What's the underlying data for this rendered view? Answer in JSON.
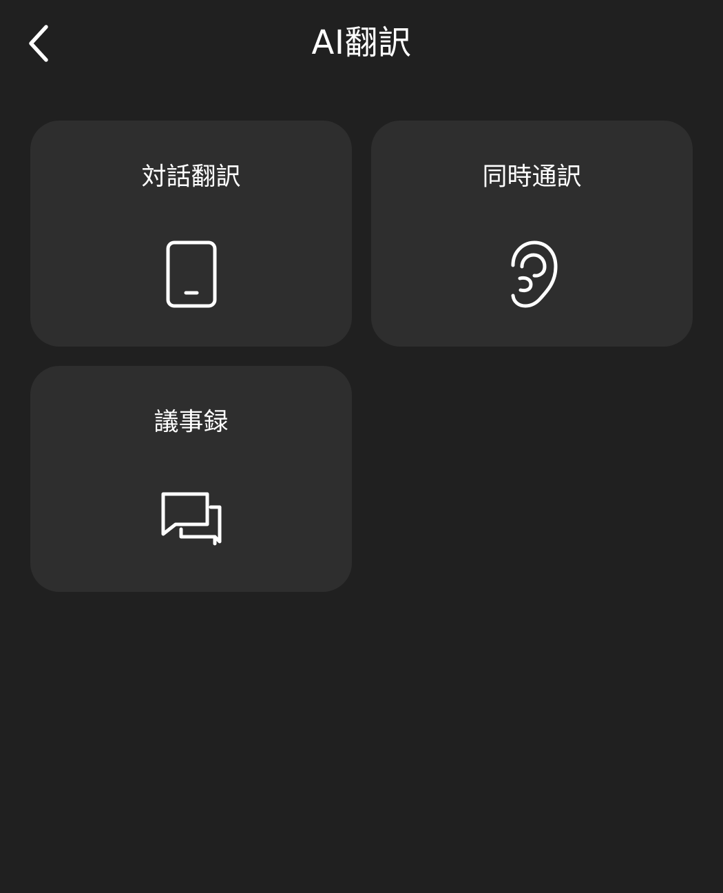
{
  "header": {
    "title": "AI翻訳",
    "back_icon": "chevron-left-icon"
  },
  "cards": [
    {
      "label": "対話翻訳",
      "icon": "phone-icon"
    },
    {
      "label": "同時通訳",
      "icon": "ear-icon"
    },
    {
      "label": "議事録",
      "icon": "chat-bubbles-icon"
    }
  ],
  "colors": {
    "background": "#202020",
    "card": "#2e2e2e",
    "foreground": "#ffffff"
  }
}
